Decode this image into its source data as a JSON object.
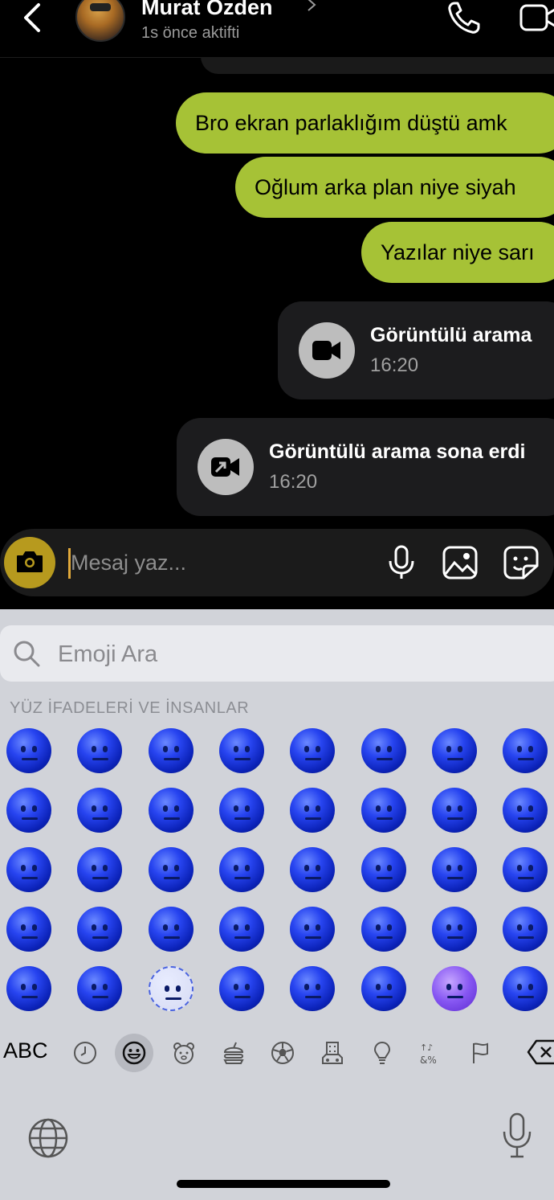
{
  "header": {
    "contact_name": "Murat Özden",
    "status": "1s önce aktifti",
    "icons": [
      "back-chevron-icon",
      "phone-icon",
      "video-camera-icon"
    ]
  },
  "messages": [
    {
      "type": "text",
      "sender": "me",
      "text": "Bro ekran parlaklığım düştü amk"
    },
    {
      "type": "text",
      "sender": "me",
      "text": "Oğlum arka plan niye siyah"
    },
    {
      "type": "text",
      "sender": "me",
      "text": "Yazılar niye sarı"
    },
    {
      "type": "call",
      "title": "Görüntülü arama",
      "time": "16:20",
      "icon": "video-camera-icon"
    },
    {
      "type": "call",
      "title": "Görüntülü arama sona erdi",
      "time": "16:20",
      "icon": "call-ended-icon"
    }
  ],
  "composer": {
    "placeholder": "Mesaj yaz...",
    "icons": [
      "camera-icon",
      "microphone-icon",
      "gallery-icon",
      "sticker-icon"
    ]
  },
  "keyboard": {
    "search_placeholder": "Emoji Ara",
    "section_title": "YÜZ İFADELERİ VE İNSANLAR",
    "abc_label": "ABC",
    "active_tab": "smileys",
    "categories": [
      "recent",
      "smileys",
      "animals",
      "food",
      "activity",
      "travel",
      "objects",
      "symbols",
      "flags"
    ],
    "emoji_rows": 5,
    "emoji_columns": 8,
    "emoji_color": "#1a3ae0"
  },
  "colors": {
    "bubble": "#a6c236",
    "camera_button": "#b79a1e",
    "call_bubble": "#1c1c1e",
    "keyboard_bg": "#d1d3d9"
  }
}
